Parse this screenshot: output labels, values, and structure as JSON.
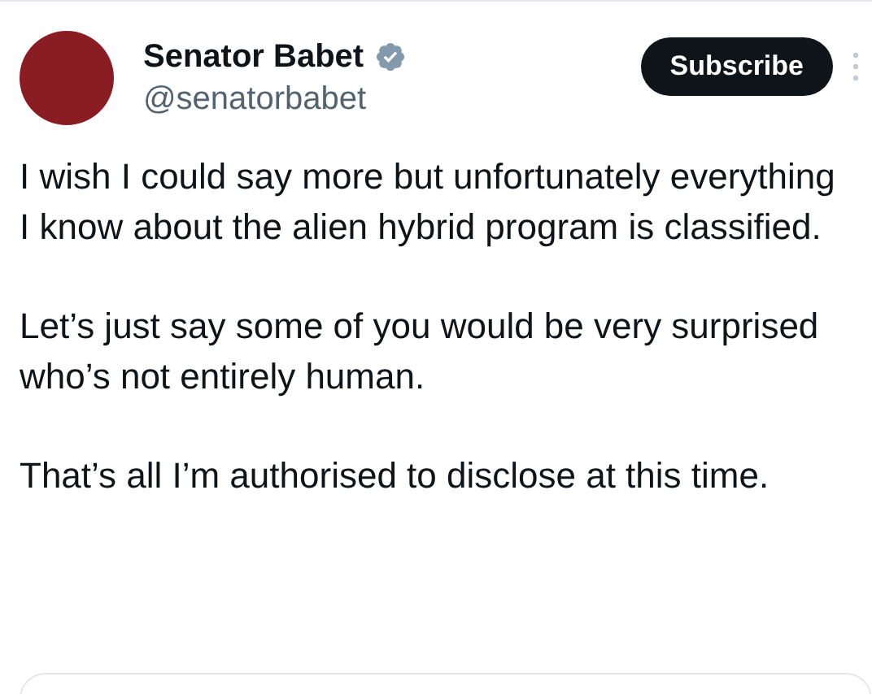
{
  "author": {
    "name": "Senator Babet",
    "verified": true,
    "handle": "@senatorbabet"
  },
  "subscribe_button": "Subscribe",
  "paragraphs": [
    "I wish I could say more but unfortunately everything I know about the alien hybrid program is classified.",
    "Let’s just say some of you would be very surprised who’s not entirely human.",
    "That’s all I’m authorised to disclose at this time."
  ]
}
